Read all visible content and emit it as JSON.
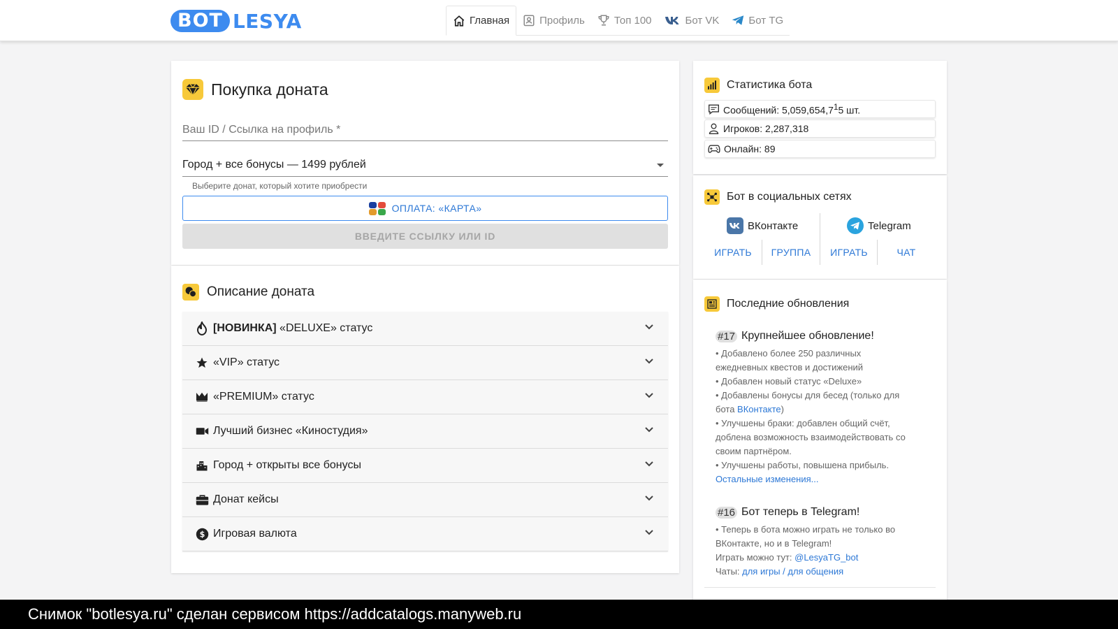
{
  "header": {
    "logo_bot": "BOT",
    "logo_lesya": "LESYA",
    "nav": [
      {
        "label": "Главная"
      },
      {
        "label": "Профиль"
      },
      {
        "label": "Топ 100"
      },
      {
        "label": "Бот VK"
      },
      {
        "label": "Бот TG"
      }
    ]
  },
  "buy": {
    "title": "Покупка доната",
    "id_placeholder": "Ваш ID / Ссылка на профиль *",
    "select_value": "Город + все бонусы — 1499 рублей",
    "hint": "Выберите донат, который хотите приобрести",
    "pay_button": "ОПЛАТА: «КАРТА»",
    "submit_button": "ВВЕДИТЕ ССЫЛКУ ИЛИ ID"
  },
  "description": {
    "title": "Описание доната",
    "items": [
      {
        "prefix": "[НОВИНКА]",
        "label": " «DELUXE» статус"
      },
      {
        "prefix": "",
        "label": "«VIP» статус"
      },
      {
        "prefix": "",
        "label": "«PREMIUM» статус"
      },
      {
        "prefix": "",
        "label": "Лучший бизнес «Киностудия»"
      },
      {
        "prefix": "",
        "label": "Город + открыты все бонусы"
      },
      {
        "prefix": "",
        "label": "Донат кейсы"
      },
      {
        "prefix": "",
        "label": "Игровая валюта"
      }
    ]
  },
  "stats": {
    "title": "Статистика бота",
    "messages": "Сообщений: 5,059,654,7",
    "messages_sup": "1",
    "messages_tail": "5 шт.",
    "players": "Игроков: 2,287,318",
    "online": "Онлайн: 89"
  },
  "social": {
    "title": "Бот в социальных сетях",
    "vk": "ВКонтакте",
    "tg": "Telegram",
    "buttons": [
      "ИГРАТЬ",
      "ГРУППА",
      "ИГРАТЬ",
      "ЧАТ"
    ]
  },
  "updates": {
    "title": "Последние обновления",
    "u17": {
      "num": "#17",
      "title": "Крупнейшее обновление!",
      "l1": "• Добавлено более 250 различных",
      "l2": "ежедневных квестов и достижений",
      "l3": "• Добавлен новый статус «Deluxe»",
      "l4": "• Добавлены бонусы для бесед (только для",
      "l5a": "бота ",
      "l5link": "ВКонтакте",
      "l5b": ")",
      "l6": "• Улучшены браки: добавлен общий счёт,",
      "l7": "доблена возможность взаимодействовать со",
      "l8": "своим партнёром.",
      "l9": "• Улучшены работы, повышена прибыль.",
      "more": "Остальные изменения..."
    },
    "u16": {
      "num": "#16",
      "title": "Бот теперь в Telegram!",
      "l1": "• Теперь в бота можно играть не только во",
      "l2": "ВКонтакте, но и в Telegram!",
      "l3": "Играть можно тут: ",
      "l3link": "@LesyaTG_bot",
      "l4": "Чаты: ",
      "l4link1": "для игры",
      "l4sep": " / ",
      "l4link2": "для общения"
    }
  },
  "footer": {
    "text": "Снимок \"botlesya.ru\" сделан сервисом https://addcatalogs.manyweb.ru"
  },
  "colors": {
    "accent": "#3d8bef",
    "link": "#2d78d6",
    "icon_bg": "#f7c93a"
  }
}
